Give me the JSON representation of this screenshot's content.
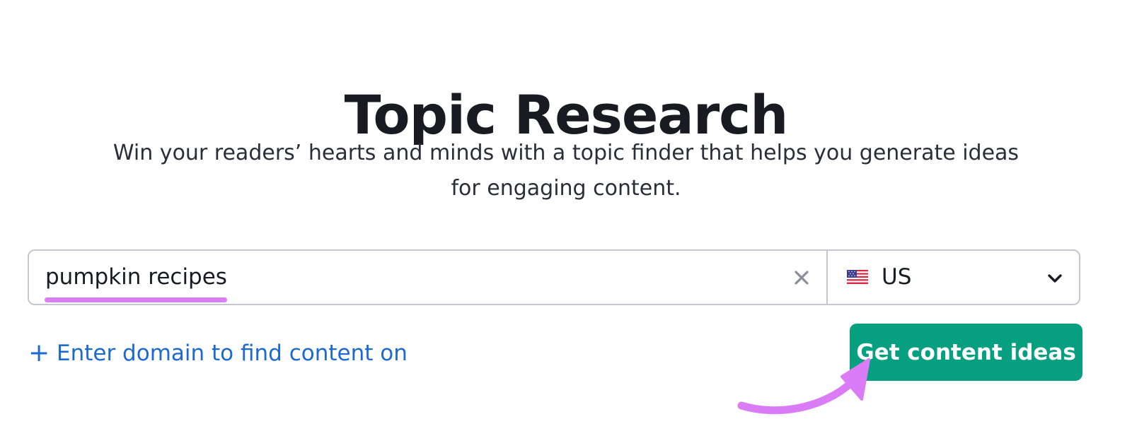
{
  "page": {
    "title": "Topic Research",
    "subtitle_line1": "Win your readers’ hearts and minds with a topic finder that helps you generate ideas",
    "subtitle_line2": "for engaging content."
  },
  "search": {
    "query_value": "pumpkin recipes",
    "clear_icon": "close-icon",
    "country": {
      "selected": "US",
      "flag_icon": "us-flag-icon",
      "chevron_icon": "chevron-down-icon"
    }
  },
  "actions": {
    "domain_link_label": "Enter domain to find content on",
    "domain_link_icon": "plus-icon",
    "submit_label": "Get content ideas"
  },
  "annotations": {
    "arrow_icon": "curved-arrow-icon",
    "highlight_color": "#d97cf5"
  },
  "colors": {
    "primary_button": "#069f7f",
    "link": "#1c69d4",
    "text": "#191b23",
    "border": "#c4c7cf"
  }
}
